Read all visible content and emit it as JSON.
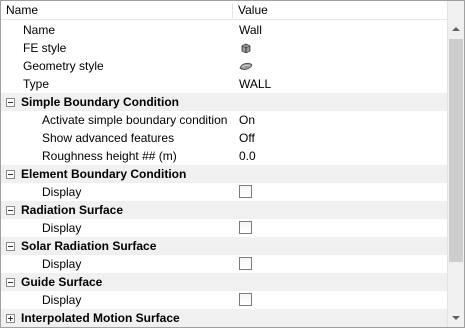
{
  "header": {
    "name_col": "Name",
    "value_col": "Value"
  },
  "props": [
    {
      "label": "Name",
      "value": "Wall"
    },
    {
      "label": "FE style",
      "icon": "fe-style-cube-icon"
    },
    {
      "label": "Geometry style",
      "icon": "geometry-style-icon"
    },
    {
      "label": "Type",
      "value": "WALL"
    }
  ],
  "simple": {
    "title": "Simple Boundary Condition",
    "activate_label": "Activate simple boundary condition",
    "activate_value": "On",
    "advanced_label": "Show advanced features",
    "advanced_value": "Off",
    "roughness_label": "Roughness height ## (m)",
    "roughness_value": "0.0"
  },
  "element": {
    "title": "Element Boundary Condition",
    "display_label": "Display",
    "checked": false
  },
  "radiation": {
    "title": "Radiation Surface",
    "display_label": "Display",
    "checked": false
  },
  "solar": {
    "title": "Solar Radiation Surface",
    "display_label": "Display",
    "checked": false
  },
  "guide": {
    "title": "Guide Surface",
    "display_label": "Display",
    "checked": false
  },
  "interpolated": {
    "title": "Interpolated Motion Surface",
    "expanded": false
  },
  "colors": {
    "category_bg": "#f0f0f0",
    "scroll_thumb": "#cdcdcd",
    "border": "#a0a0a0"
  }
}
